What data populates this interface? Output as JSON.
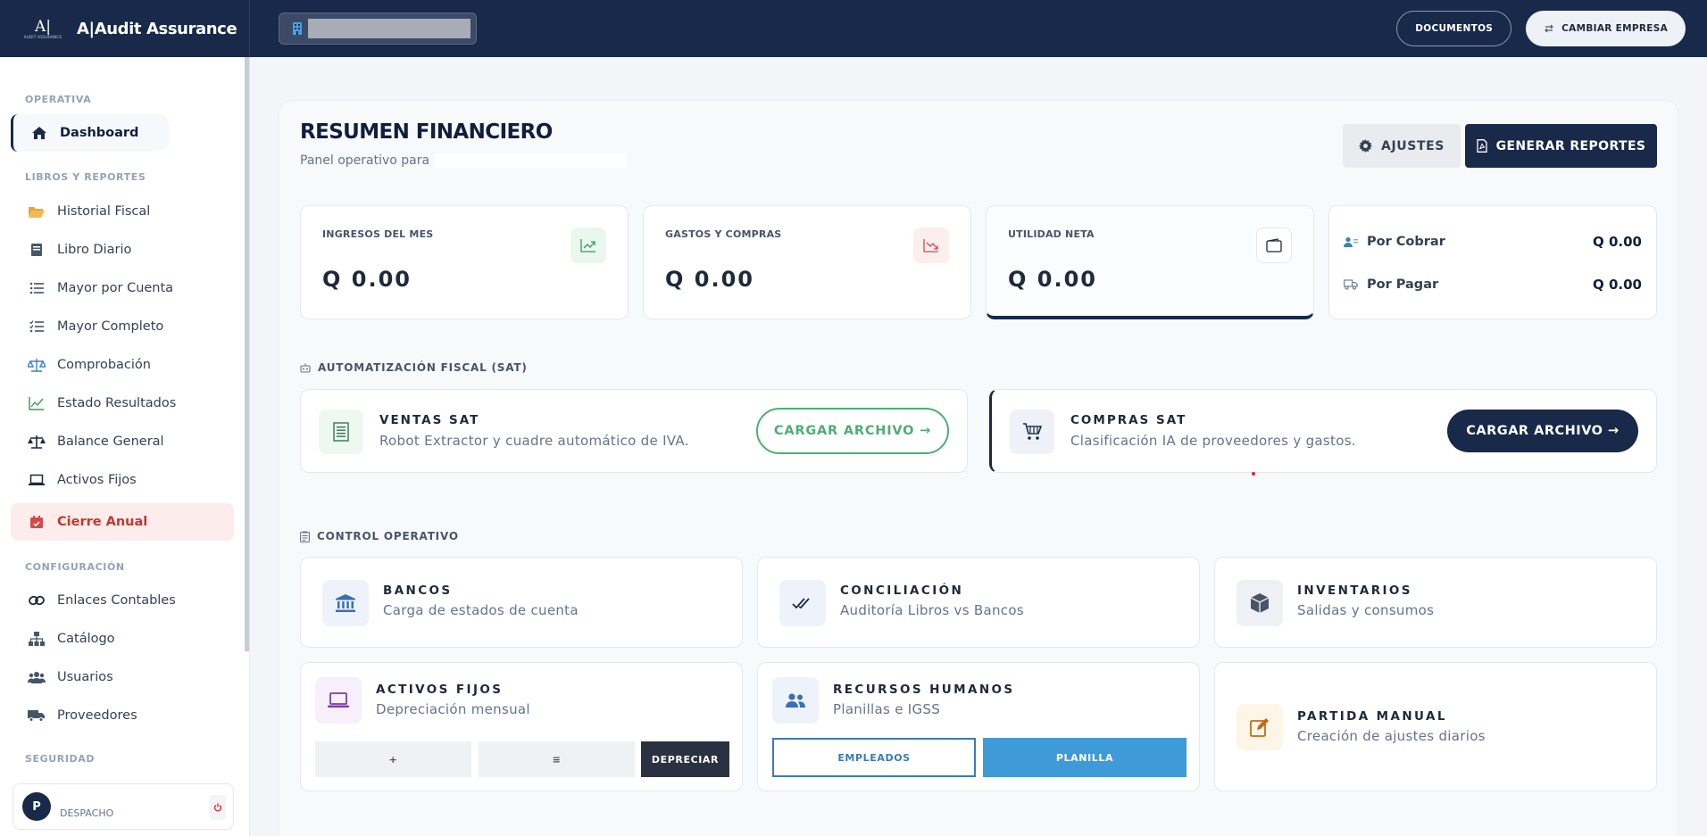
{
  "app": {
    "brand_mark": "A|",
    "brand_mark_sub": "AUDIT ASSURANCE",
    "brand_name": "A|Audit Assurance",
    "top_actions": {
      "documents": "DOCUMENTOS",
      "change_company": "CAMBIAR EMPRESA"
    }
  },
  "sidebar": {
    "sections": {
      "operativa": "OPERATIVA",
      "libros": "LIBROS Y REPORTES",
      "config": "CONFIGURACIÓN",
      "seguridad": "SEGURIDAD"
    },
    "items": {
      "dashboard": "Dashboard",
      "historial": "Historial Fiscal",
      "diario": "Libro Diario",
      "mayor_cuenta": "Mayor por Cuenta",
      "mayor_completo": "Mayor Completo",
      "comprobacion": "Comprobación",
      "resultados": "Estado Resultados",
      "balance": "Balance General",
      "activos": "Activos Fijos",
      "cierre": "Cierre Anual",
      "enlaces": "Enlaces Contables",
      "catalogo": "Catálogo",
      "usuarios": "Usuarios",
      "proveedores": "Proveedores"
    },
    "user": {
      "initial": "P",
      "role": "DESPACHO"
    }
  },
  "main": {
    "title": "RESUMEN FINANCIERO",
    "subtitle": "Panel operativo para",
    "buttons": {
      "settings": "AJUSTES",
      "reports": "GENERAR REPORTES"
    },
    "kpis": {
      "ingresos": {
        "label": "INGRESOS DEL MES",
        "value": "Q 0.00"
      },
      "gastos": {
        "label": "GASTOS Y COMPRAS",
        "value": "Q 0.00"
      },
      "utilidad": {
        "label": "UTILIDAD NETA",
        "value": "Q 0.00"
      },
      "por_cobrar": {
        "label": "Por Cobrar",
        "value": "Q 0.00"
      },
      "por_pagar": {
        "label": "Por Pagar",
        "value": "Q 0.00"
      }
    },
    "sat": {
      "heading": "AUTOMATIZACIÓN FISCAL (SAT)",
      "ventas": {
        "title": "VENTAS SAT",
        "desc": "Robot Extractor y cuadre automático de IVA.",
        "button": "CARGAR ARCHIVO →"
      },
      "compras": {
        "title": "COMPRAS SAT",
        "desc": "Clasificación IA de proveedores y gastos.",
        "button": "CARGAR ARCHIVO →"
      }
    },
    "control": {
      "heading": "CONTROL OPERATIVO",
      "bancos": {
        "title": "BANCOS",
        "desc": "Carga de estados de cuenta"
      },
      "conciliacion": {
        "title": "CONCILIACIÓN",
        "desc": "Auditoría Libros vs Bancos"
      },
      "inventarios": {
        "title": "INVENTARIOS",
        "desc": "Salidas y consumos"
      },
      "activos": {
        "title": "ACTIVOS FIJOS",
        "desc": "Depreciación mensual",
        "add": "+",
        "list": "≡",
        "depreciar": "DEPRECIAR"
      },
      "rrhh": {
        "title": "RECURSOS HUMANOS",
        "desc": "Planillas e IGSS",
        "empleados": "EMPLEADOS",
        "planilla": "PLANILLA"
      },
      "partida": {
        "title": "PARTIDA MANUAL",
        "desc": "Creación de ajustes diarios"
      }
    }
  }
}
